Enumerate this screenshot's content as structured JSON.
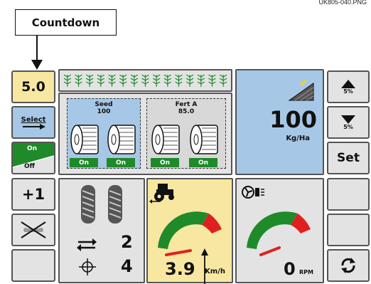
{
  "ref_code": "UK805-040.PNG",
  "callout": {
    "label": "Countdown"
  },
  "left_col": {
    "countdown_value": "5.0",
    "select_label": "Select",
    "on_label": "On",
    "off_label": "Off",
    "plus_label": "+1"
  },
  "metering": {
    "seed_title": "Seed",
    "seed_value": "100",
    "fert_title": "Fert A",
    "fert_value": "85.0",
    "motor_status": [
      "On",
      "On",
      "On",
      "On"
    ]
  },
  "rate": {
    "value": "100",
    "unit": "Kg/Ha"
  },
  "right_col": {
    "up_pct": "5%",
    "down_pct": "5%",
    "set_label": "Set"
  },
  "tramline": {
    "interval": "2",
    "position": "4"
  },
  "speed": {
    "value": "3.9",
    "unit": "Km/h"
  },
  "fan": {
    "value": "0",
    "unit": "RPM"
  },
  "colors": {
    "blue": "#a7c7e6",
    "yellow": "#f7e7a1",
    "green": "#1f8a2a",
    "red": "#e02020"
  }
}
